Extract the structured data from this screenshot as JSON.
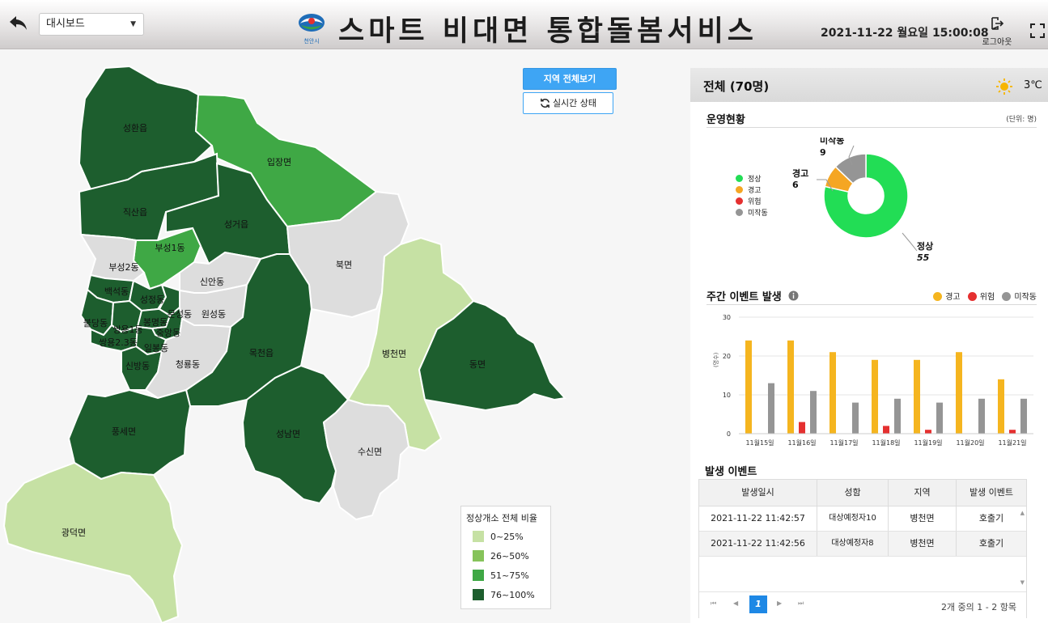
{
  "header": {
    "select_value": "대시보드",
    "logo_text": "천안시",
    "title": "스마트 비대면 통합돌봄서비스",
    "datetime": "2021-11-22 월요일 15:00:08",
    "logout_label": "로그아웃"
  },
  "map": {
    "btn_all": "지역 전체보기",
    "btn_realtime": "실시간 상태",
    "regions": {
      "seonghwan": "성환읍",
      "jiksan": "직산읍",
      "ipjang": "입장면",
      "seonggeo": "성거읍",
      "buseong1": "부성1동",
      "buseong2": "부성2동",
      "buk": "북면",
      "sinan": "신안동",
      "baekseok": "백석동",
      "seongjeong": "성정동",
      "munseong": "문성동",
      "wonseong": "원성동",
      "buldang": "불당동",
      "ssangyong1": "쌍용1동",
      "bongmyeong": "봉명동",
      "jungang": "중앙동",
      "ssangyong23": "쌍용2.3동",
      "ilbong": "일봉동",
      "sinbang": "신방동",
      "cheongryong": "청룡동",
      "mokcheon": "목천읍",
      "byeongcheon": "병천면",
      "dongmyeon": "동면",
      "pungse": "풍세면",
      "seongnam": "성남면",
      "susin": "수신면",
      "gwangdeok": "광덕면"
    },
    "legend": {
      "title": "정상개소 전체 비율",
      "items": [
        {
          "label": "0~25%",
          "color": "#c6e1a4"
        },
        {
          "label": "26~50%",
          "color": "#86c35a"
        },
        {
          "label": "51~75%",
          "color": "#3fa845"
        },
        {
          "label": "76~100%",
          "color": "#1d5e2e"
        }
      ]
    }
  },
  "panel": {
    "title": "전체 (70명)",
    "weather_icon": "sun-icon",
    "temperature": "3℃",
    "ops_title": "운영현황",
    "unit": "(단위: 명)",
    "donut": {
      "legend": [
        {
          "label": "정상",
          "color": "#22dd55"
        },
        {
          "label": "경고",
          "color": "#f5a623"
        },
        {
          "label": "위험",
          "color": "#e53030"
        },
        {
          "label": "미작동",
          "color": "#959595"
        }
      ],
      "values": [
        {
          "name": "정상",
          "value": "55",
          "color": "#22dd55"
        },
        {
          "name": "경고",
          "value": "6",
          "color": "#f5a623"
        },
        {
          "name": "미작동",
          "value": "9",
          "color": "#959595"
        }
      ]
    },
    "weekly_title": "주간 이벤트 발생",
    "bar_legend": [
      {
        "label": "경고",
        "color": "#f5b51f"
      },
      {
        "label": "위험",
        "color": "#e53030"
      },
      {
        "label": "미작동",
        "color": "#959595"
      }
    ],
    "events_title": "발생 이벤트",
    "table": {
      "headers": [
        "발생일시",
        "성함",
        "지역",
        "발생 이벤트"
      ],
      "rows": [
        [
          "2021-11-22 11:42:57",
          "대상예정자10",
          "병천면",
          "호출기"
        ],
        [
          "2021-11-22 11:42:56",
          "대상예정자8",
          "병천면",
          "호출기"
        ]
      ]
    },
    "pager": {
      "current": "1",
      "info": "2개 중의 1 - 2 항목"
    }
  },
  "chart_data": {
    "type": "bar",
    "categories": [
      "11월15일",
      "11월16일",
      "11월17일",
      "11월18일",
      "11월19일",
      "11월20일",
      "11월21일"
    ],
    "series": [
      {
        "name": "경고",
        "values": [
          24,
          24,
          21,
          19,
          19,
          21,
          14
        ],
        "color": "#f5b51f"
      },
      {
        "name": "위험",
        "values": [
          0,
          3,
          0,
          2,
          1,
          0,
          1
        ],
        "color": "#e53030"
      },
      {
        "name": "미작동",
        "values": [
          13,
          11,
          8,
          9,
          8,
          9,
          9
        ],
        "color": "#959595"
      }
    ],
    "ylim": [
      0,
      30
    ],
    "yticks": [
      "0",
      "10",
      "20",
      "30"
    ],
    "ylabel": "(명수)",
    "grid": true
  }
}
